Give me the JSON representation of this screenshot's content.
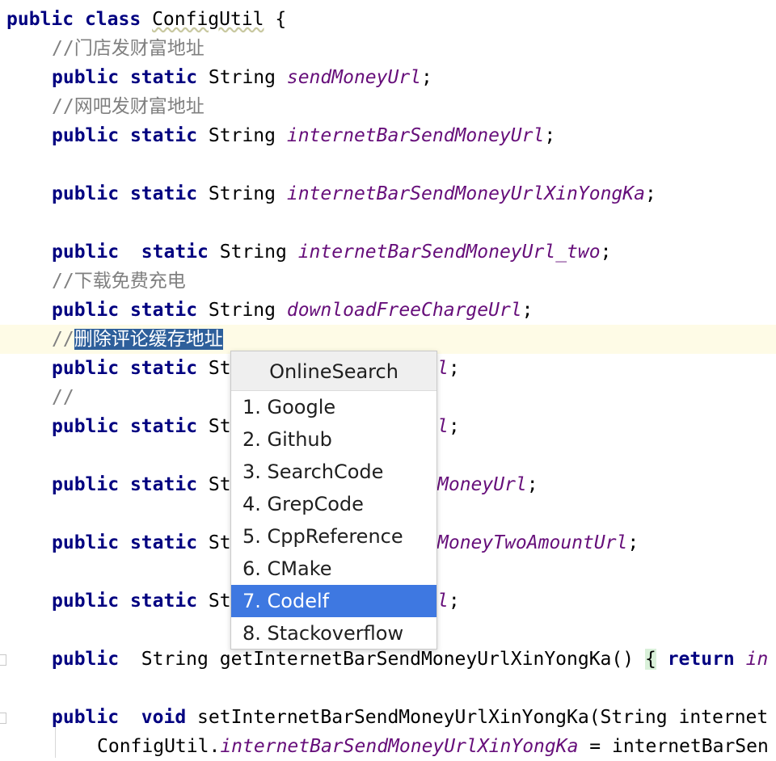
{
  "editor": {
    "class_decl": {
      "kw_public": "public",
      "kw_class": "class",
      "name": "ConfigUtil",
      "brace": "{"
    },
    "comment_store": "//门店发财富地址",
    "comment_netbar": "//网吧发财富地址",
    "comment_download": "//下载免费充电",
    "comment_delete_prefix": "//",
    "comment_delete_selected": "删除评论缓存地址",
    "comment_empty": "//",
    "kw_public": "public",
    "kw_static": "static",
    "kw_void": "void",
    "kw_return": "return",
    "type_string": "String",
    "type_string_partial": "St",
    "field_send_money": "sendMoneyUrl",
    "field_netbar": "internetBarSendMoneyUrl",
    "field_netbar_xyk": "internetBarSendMoneyUrlXinYongKa",
    "field_netbar_two": "internetBarSendMoneyUrl_two",
    "field_download": "downloadFreeChargeUrl",
    "tail_l1": "l",
    "tail_l2": "l",
    "tail_money": "MoneyUrl",
    "tail_two_amount": "MoneyTwoAmountUrl",
    "tail_l3": "l",
    "semicolon": ";",
    "getter_sig": "getInternetBarSendMoneyUrlXinYongKa()",
    "getter_brace": "{",
    "getter_tail": "in",
    "setter_sig": "setInternetBarSendMoneyUrlXinYongKa(String internet",
    "assign_obj": "ConfigUtil.",
    "assign_field": "internetBarSendMoneyUrlXinYongKa",
    "assign_rest": " = internetBarSen"
  },
  "popup": {
    "title": "OnlineSearch",
    "items": [
      "1. Google",
      "2. Github",
      "3. SearchCode",
      "4. GrepCode",
      "5. CppReference",
      "6. CMake",
      "7. Codelf",
      "8. Stackoverflow"
    ],
    "selected": "7. Codelf"
  }
}
